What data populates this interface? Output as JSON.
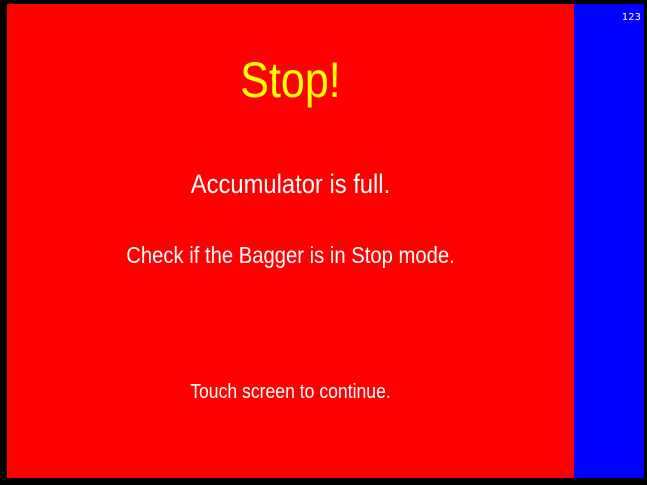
{
  "alert": {
    "title": "Stop!",
    "line1": "Accumulator is full.",
    "line2": "Check if the Bagger is in Stop mode.",
    "prompt": "Touch screen to continue."
  },
  "side_panel": {
    "number": "123"
  },
  "colors": {
    "alert_background": "#ff0000",
    "side_background": "#0000ff",
    "title_text": "#ffff00",
    "body_text": "#ffffff"
  }
}
